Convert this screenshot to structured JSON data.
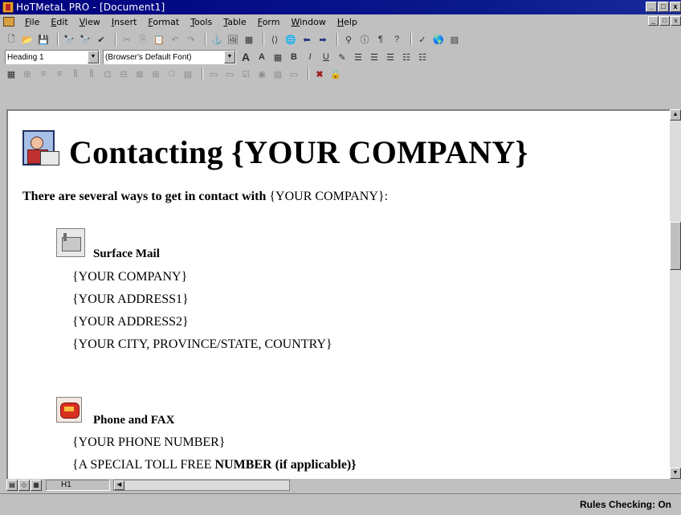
{
  "window": {
    "title": "HoTMetaL PRO - [Document1]",
    "buttons": [
      "_",
      "□",
      "x"
    ],
    "mdi_buttons": [
      "_",
      "□",
      "x"
    ]
  },
  "menu": [
    "File",
    "Edit",
    "View",
    "Insert",
    "Format",
    "Tools",
    "Table",
    "Form",
    "Window",
    "Help"
  ],
  "format_toolbar": {
    "style_value": "Heading 1",
    "font_value": "(Browser's Default Font)"
  },
  "document": {
    "heading": "Contacting {YOUR COMPANY}",
    "intro_bold": "There are several ways to get in contact with",
    "intro_regular": " {YOUR COMPANY}:",
    "mail": {
      "title": "Surface Mail",
      "lines": [
        "{YOUR COMPANY}",
        "{YOUR ADDRESS1}",
        "{YOUR ADDRESS2}",
        "{YOUR CITY, PROVINCE/STATE, COUNTRY}"
      ]
    },
    "phone": {
      "title": "Phone and FAX",
      "line1": "{YOUR PHONE NUMBER}",
      "line2_regular": "{A SPECIAL TOLL FREE ",
      "line2_bold": "NUMBER (if applicable)}"
    }
  },
  "bottom": {
    "tag_label": "H1"
  },
  "status": {
    "rules": "Rules Checking: On"
  },
  "icons": {
    "app": "hotmetal-app-icon",
    "heading": "contact-person-icon",
    "mail": "mailbox-icon",
    "phone": "telephone-icon"
  },
  "colors": {
    "titlebar": "#000080",
    "chrome": "#c0c0c0",
    "document": "#ffffff"
  }
}
